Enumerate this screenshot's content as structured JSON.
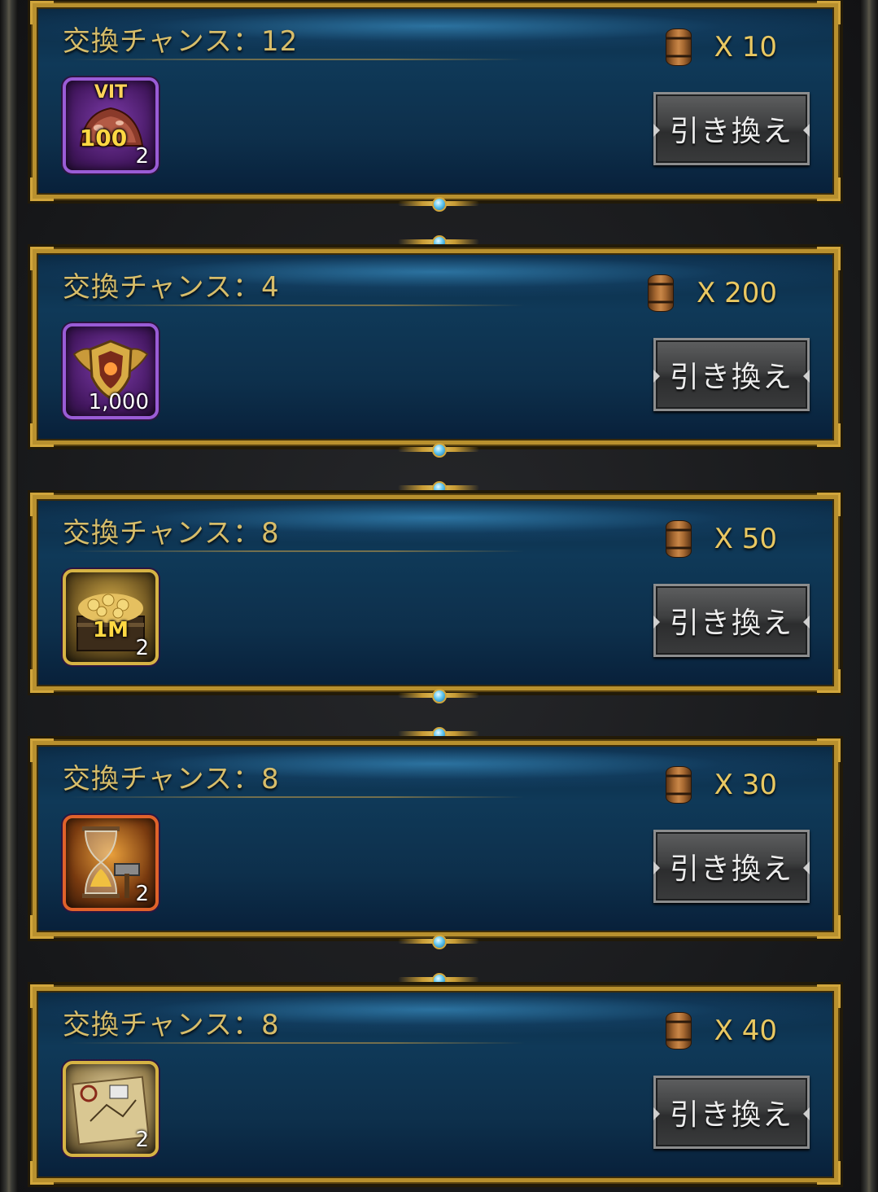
{
  "offers": [
    {
      "title": "交換チャンス：12",
      "cost": "X 10",
      "item_tag": "100",
      "item_subtag": "VIT",
      "item_qty": "2",
      "button": "引き換え",
      "item_icon": "vit-meat-icon",
      "frame": "purple"
    },
    {
      "title": "交換チャンス：4",
      "cost": "X 200",
      "item_tag": "",
      "item_subtag": "",
      "item_qty": "1,000",
      "button": "引き換え",
      "item_icon": "winged-shield-medal-icon",
      "frame": "purple"
    },
    {
      "title": "交換チャンス：8",
      "cost": "X 50",
      "item_tag": "1M",
      "item_subtag": "",
      "item_qty": "2",
      "button": "引き換え",
      "item_icon": "gold-chest-icon",
      "frame": "gold"
    },
    {
      "title": "交換チャンス：8",
      "cost": "X 30",
      "item_tag": "",
      "item_subtag": "",
      "item_qty": "2",
      "button": "引き換え",
      "item_icon": "hourglass-hammer-icon",
      "frame": "orange"
    },
    {
      "title": "交換チャンス：8",
      "cost": "X 40",
      "item_tag": "",
      "item_subtag": "",
      "item_qty": "2",
      "button": "引き換え",
      "item_icon": "blueprint-map-icon",
      "frame": "tan"
    }
  ],
  "currency_icon": "barrel-icon",
  "colors": {
    "frame_gold": "#b8902e",
    "panel_blue": "#0f3958",
    "title_text": "#d7bd6a",
    "cost_text": "#e9c862"
  }
}
